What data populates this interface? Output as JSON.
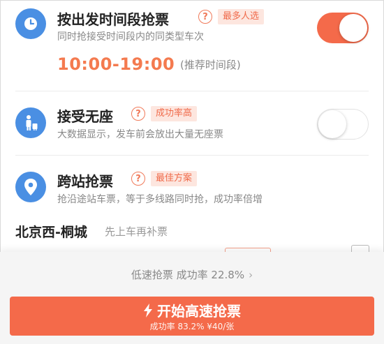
{
  "options": [
    {
      "title": "按出发时间段抢票",
      "tag": "最多人选",
      "description": "同时抢接受时间段内的同类型车次",
      "time_range": "10:00-19:00",
      "time_note": "(推荐时间段)",
      "toggle_state": "on",
      "icon": "clock-icon"
    },
    {
      "title": "接受无座",
      "tag": "成功率高",
      "description": "大数据显示，发车前会放出大量无座票",
      "toggle_state": "off",
      "icon": "standing-passenger-icon"
    },
    {
      "title": "跨站抢票",
      "tag": "最佳方案",
      "description": "抢沿途站车票，等于多线路同时抢，成功率倍增",
      "icon": "location-pin-icon"
    }
  ],
  "station": {
    "route": "北京西-桐城",
    "note": "先上车再补票"
  },
  "low_speed": {
    "label": "低速抢票 成功率 22.8%",
    "chevron": "›"
  },
  "main_button": {
    "label": "开始高速抢票",
    "subtitle": "成功率 83.2% ¥40/张",
    "icon": "lightning-icon"
  },
  "colors": {
    "accent": "#f46a4a",
    "icon_blue": "#4a8fe3",
    "time_orange": "#f47a4f",
    "tag_bg": "#fde6df"
  }
}
